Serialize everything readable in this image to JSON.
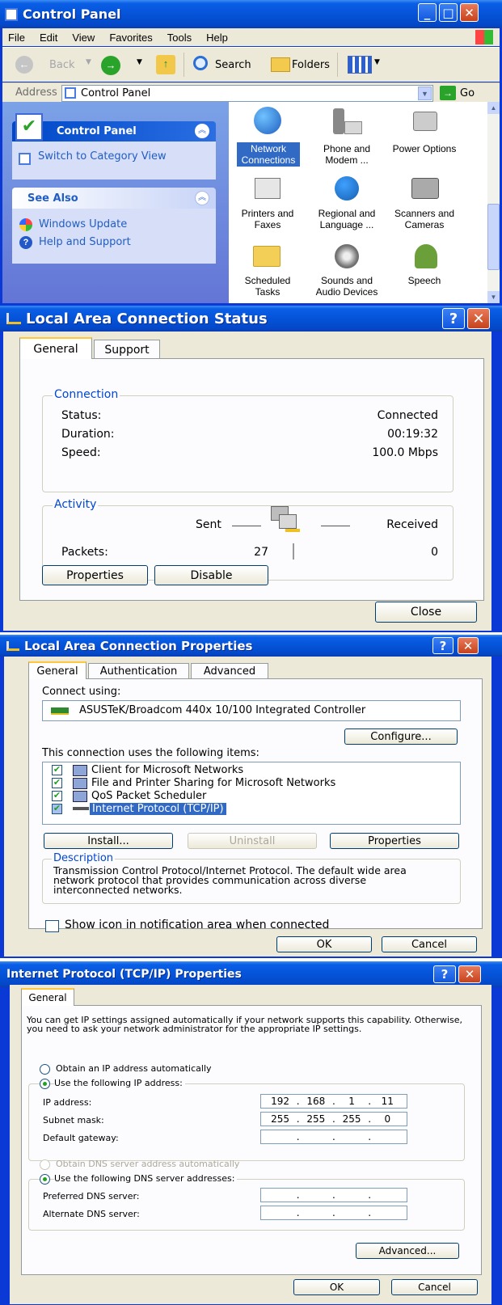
{
  "control_panel": {
    "title": "Control Panel",
    "menu": [
      "File",
      "Edit",
      "View",
      "Favorites",
      "Tools",
      "Help"
    ],
    "toolbar": {
      "back": "Back",
      "search": "Search",
      "folders": "Folders"
    },
    "address": {
      "label": "Address",
      "value": "Control Panel",
      "go": "Go"
    },
    "side_panel": {
      "title": "Control Panel",
      "switch_view": "Switch to Category View",
      "see_also_title": "See Also",
      "links": [
        "Windows Update",
        "Help and Support"
      ]
    },
    "icons": [
      {
        "line1": "Network",
        "line2": "Connections",
        "icon": "network-globe-icon"
      },
      {
        "line1": "Phone and",
        "line2": "Modem ...",
        "icon": "phone-icon"
      },
      {
        "line1": "Power Options",
        "line2": "",
        "icon": "power-plug-icon"
      },
      {
        "line1": "Printers and",
        "line2": "Faxes",
        "icon": "printer-icon"
      },
      {
        "line1": "Regional and",
        "line2": "Language ...",
        "icon": "globe-icon"
      },
      {
        "line1": "Scanners and",
        "line2": "Cameras",
        "icon": "camera-icon"
      },
      {
        "line1": "Scheduled",
        "line2": "Tasks",
        "icon": "folder-clock-icon"
      },
      {
        "line1": "Sounds and",
        "line2": "Audio Devices",
        "icon": "speaker-icon"
      },
      {
        "line1": "Speech",
        "line2": "",
        "icon": "speech-icon"
      }
    ]
  },
  "lac_status": {
    "title": "Local Area Connection Status",
    "tabs": [
      "General",
      "Support"
    ],
    "connection_legend": "Connection",
    "status_label": "Status:",
    "status_value": "Connected",
    "duration_label": "Duration:",
    "duration_value": "00:19:32",
    "speed_label": "Speed:",
    "speed_value": "100.0 Mbps",
    "activity_legend": "Activity",
    "sent_label": "Sent",
    "received_label": "Received",
    "packets_label": "Packets:",
    "packets_sent": "27",
    "packets_received": "0",
    "properties_btn": "Properties",
    "disable_btn": "Disable",
    "close_btn": "Close"
  },
  "lac_props": {
    "title": "Local Area Connection Properties",
    "tabs": [
      "General",
      "Authentication",
      "Advanced"
    ],
    "connect_using_label": "Connect using:",
    "adapter": "ASUSTeK/Broadcom 440x 10/100 Integrated Controller",
    "configure_btn": "Configure...",
    "items_label": "This connection uses the following items:",
    "items": [
      "Client for Microsoft Networks",
      "File and Printer Sharing for Microsoft Networks",
      "QoS Packet Scheduler",
      "Internet Protocol (TCP/IP)"
    ],
    "install_btn": "Install...",
    "uninstall_btn": "Uninstall",
    "properties_btn": "Properties",
    "description_legend": "Description",
    "description": "Transmission Control Protocol/Internet Protocol. The default wide area network protocol that provides communication across diverse interconnected networks.",
    "show_icon": "Show icon in notification area when connected",
    "ok_btn": "OK",
    "cancel_btn": "Cancel"
  },
  "tcpip": {
    "title": "Internet Protocol (TCP/IP) Properties",
    "tab": "General",
    "intro": "You can get IP settings assigned automatically if your network supports this capability. Otherwise, you need to ask your network administrator for the appropriate IP settings.",
    "obtain_ip": "Obtain an IP address automatically",
    "use_ip": "Use the following IP address:",
    "ip_label": "IP address:",
    "ip": [
      "192",
      "168",
      "1",
      "11"
    ],
    "mask_label": "Subnet mask:",
    "mask": [
      "255",
      "255",
      "255",
      "0"
    ],
    "gateway_label": "Default gateway:",
    "obtain_dns": "Obtain DNS server address automatically",
    "use_dns": "Use the following DNS server addresses:",
    "preferred_dns": "Preferred DNS server:",
    "alternate_dns": "Alternate DNS server:",
    "advanced_btn": "Advanced...",
    "ok_btn": "OK",
    "cancel_btn": "Cancel"
  }
}
